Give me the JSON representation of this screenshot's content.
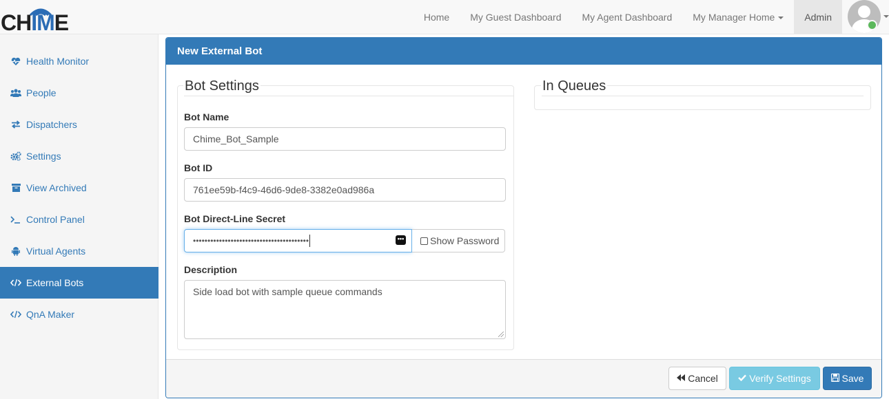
{
  "brand": {
    "name_pre": "CH",
    "name_accent": "IM",
    "name_post": "E"
  },
  "nav": {
    "items": [
      {
        "label": "Home"
      },
      {
        "label": "My Guest Dashboard"
      },
      {
        "label": "My Agent Dashboard"
      },
      {
        "label": "My Manager Home"
      },
      {
        "label": "Admin"
      }
    ],
    "user_status": "online"
  },
  "sidebar": {
    "items": [
      {
        "label": "Health Monitor",
        "icon": "heartbeat-icon"
      },
      {
        "label": "People",
        "icon": "users-icon"
      },
      {
        "label": "Dispatchers",
        "icon": "exchange-icon"
      },
      {
        "label": "Settings",
        "icon": "cogs-icon"
      },
      {
        "label": "View Archived",
        "icon": "archive-icon"
      },
      {
        "label": "Control Panel",
        "icon": "terminal-icon"
      },
      {
        "label": "Virtual Agents",
        "icon": "android-icon"
      },
      {
        "label": "External Bots",
        "icon": "code-icon"
      },
      {
        "label": "QnA Maker",
        "icon": "code-icon"
      }
    ],
    "active_index": 7
  },
  "panel": {
    "title": "New External Bot",
    "bot_settings": {
      "legend": "Bot Settings",
      "bot_name_label": "Bot Name",
      "bot_name_value": "Chime_Bot_Sample",
      "bot_id_label": "Bot ID",
      "bot_id_value": "761ee59b-f4c9-46d6-9de8-3382e0ad986a",
      "secret_label": "Bot Direct-Line Secret",
      "secret_value": "••••••••••••••••••••••••••••••••••••••••",
      "show_password_label": "Show Password",
      "description_label": "Description",
      "description_value": "Side load bot with sample queue commands"
    },
    "in_queues": {
      "legend": "In Queues"
    },
    "footer": {
      "cancel_label": "Cancel",
      "verify_label": "Verify Settings",
      "save_label": "Save"
    }
  },
  "colors": {
    "primary": "#337ab7",
    "info": "#5bc0de",
    "status_online": "#5cb85c"
  }
}
